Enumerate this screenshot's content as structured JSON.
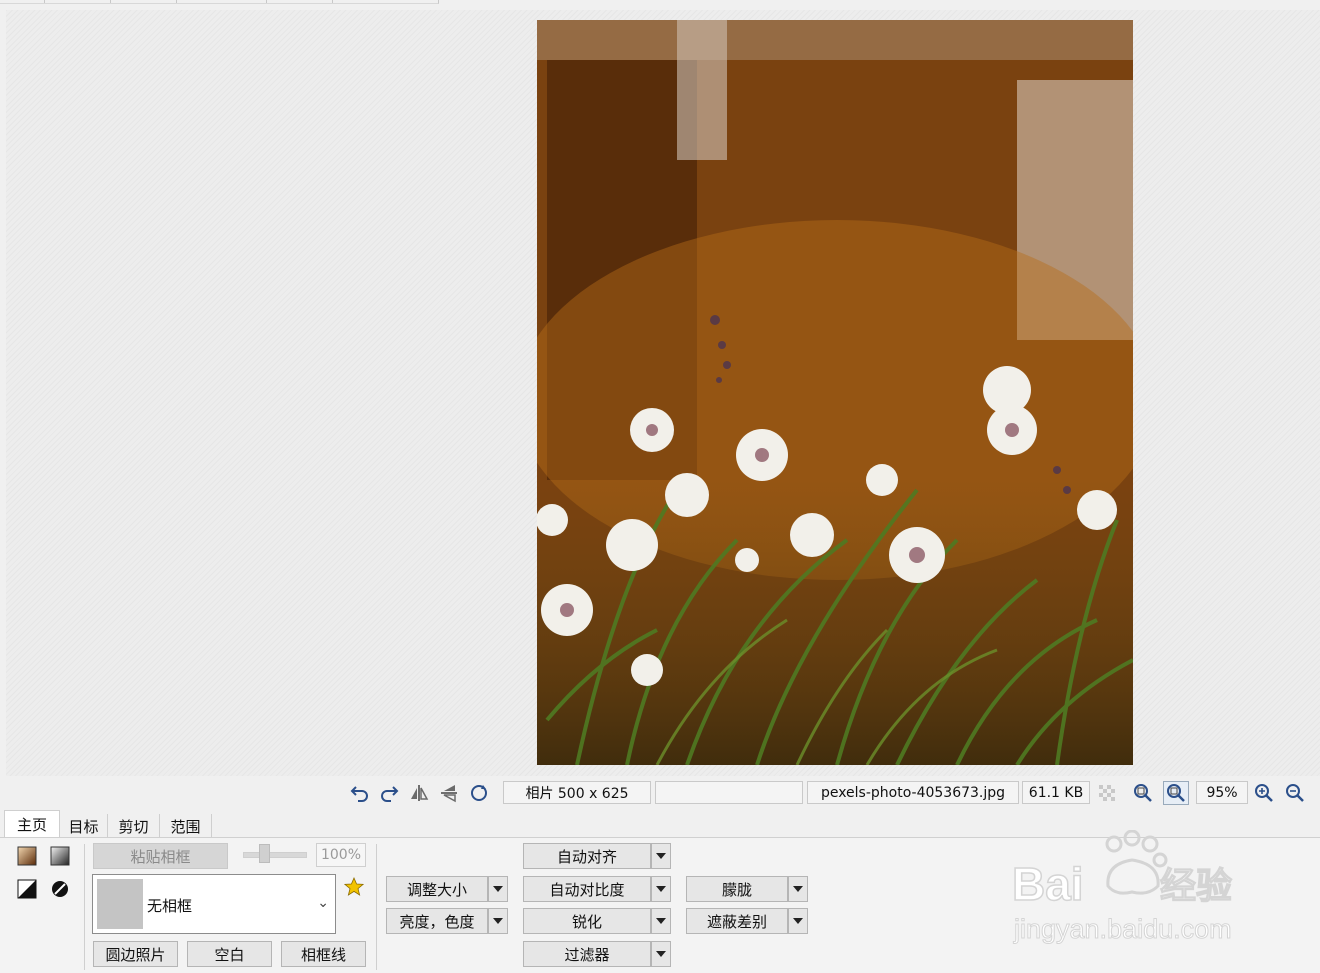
{
  "status_bar": {
    "photo_size": "相片 500 x 625",
    "blank_field": "",
    "filename": "pexels-photo-4053673.jpg",
    "filesize": "61.1 KB",
    "zoom": "95%"
  },
  "tabs": [
    {
      "label": "主页",
      "active": true
    },
    {
      "label": "目标",
      "active": false
    },
    {
      "label": "剪切",
      "active": false
    },
    {
      "label": "范围",
      "active": false
    }
  ],
  "frame_panel": {
    "paste_frame": "粘贴相框",
    "opacity": "100%",
    "frame_select_value": "无相框",
    "rounded_photo": "圆边照片",
    "blank": "空白",
    "frame_line": "相框线"
  },
  "adjust": {
    "resize": "调整大小",
    "brightness_color": "亮度，色度",
    "auto_align": "自动对齐",
    "auto_contrast": "自动对比度",
    "sharpen": "锐化",
    "filter": "过滤器",
    "blur": "朦胧",
    "mask_diff": "遮蔽差别"
  },
  "watermark": {
    "brand": "Bai du 经验",
    "url": "jingyan.baidu.com"
  },
  "colors": {
    "panel_bg": "#f3f3f3",
    "button_bg": "#e6e6e6",
    "photo_tone": "#8a4b10",
    "star": "#f2c300"
  },
  "icons": [
    "undo-icon",
    "redo-icon",
    "flip-horizontal-icon",
    "flip-vertical-icon",
    "rotate-icon",
    "checkerboard-icon",
    "zoom-fit-icon",
    "zoom-actual-icon",
    "zoom-in-icon",
    "zoom-out-icon",
    "gradient-brown-icon",
    "gradient-gray-icon",
    "bw-triangle-icon",
    "ring-icon",
    "star-icon"
  ]
}
